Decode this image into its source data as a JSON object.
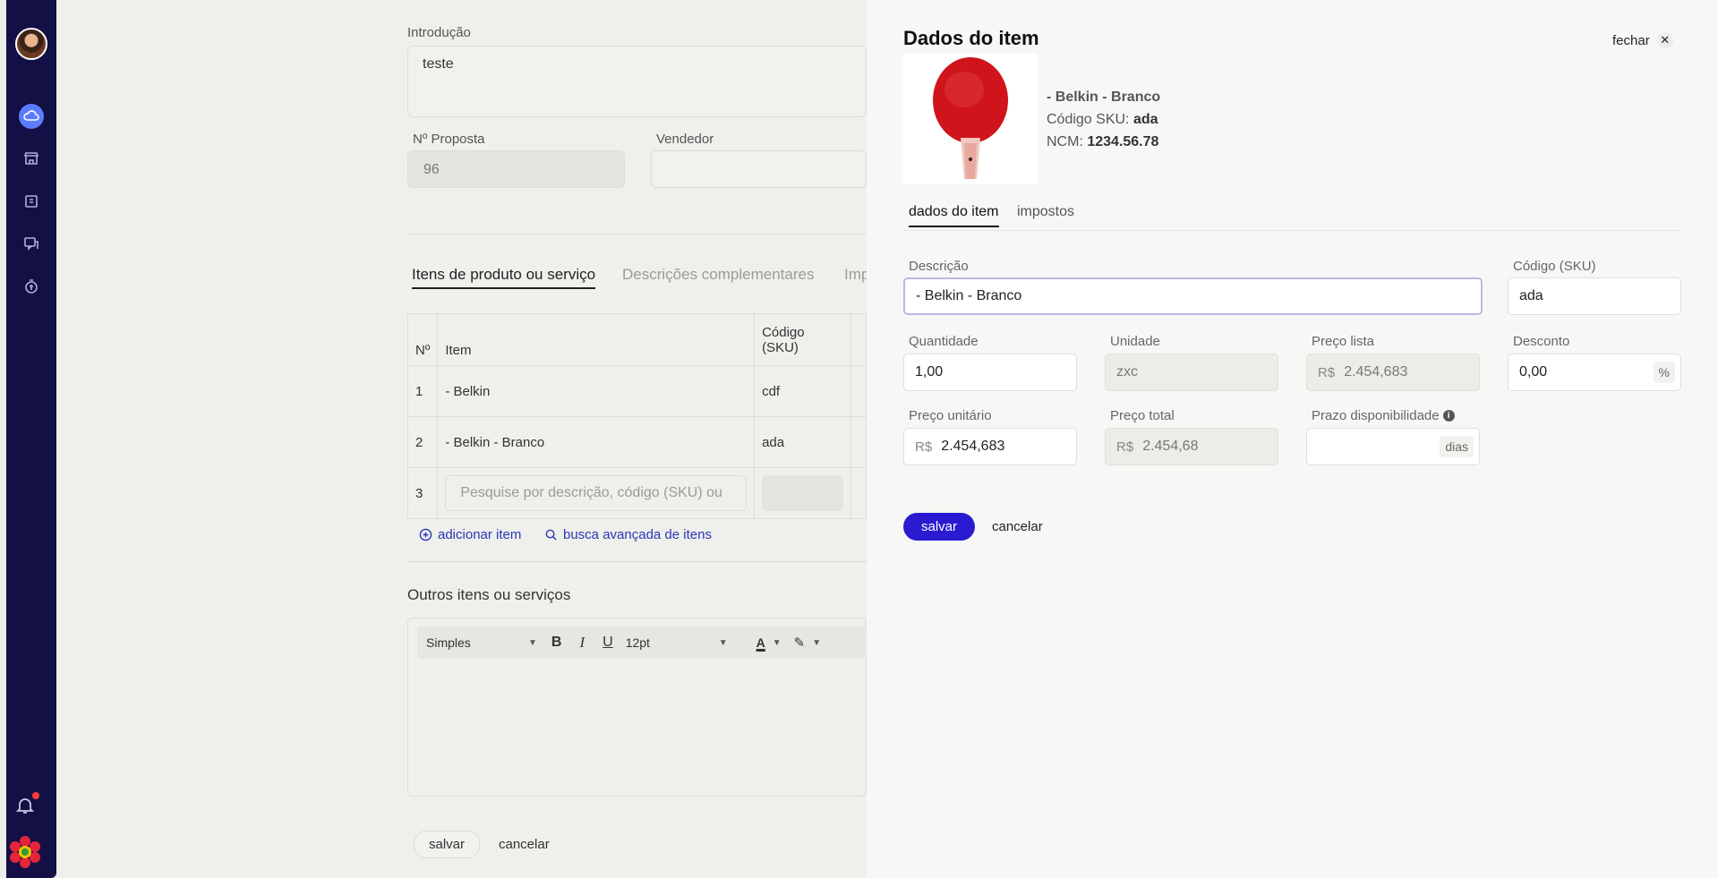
{
  "background": {
    "intro_label": "Introdução",
    "intro_value": "teste",
    "proposta_label": "Nº Proposta",
    "proposta_value": "96",
    "vendedor_label": "Vendedor",
    "tabs": [
      "Itens de produto ou serviço",
      "Descrições complementares",
      "Imp"
    ],
    "table": {
      "headers": [
        "Nº",
        "Item",
        "Código (SKU)"
      ],
      "rows": [
        {
          "n": "1",
          "item": "- Belkin",
          "sku": "cdf"
        },
        {
          "n": "2",
          "item": "- Belkin - Branco",
          "sku": "ada"
        },
        {
          "n": "3",
          "placeholder": "Pesquise por descrição, código (SKU) ou"
        }
      ]
    },
    "add_item": "adicionar item",
    "advanced_search": "busca avançada de itens",
    "outros_title": "Outros itens ou serviços",
    "toolbar": {
      "style": "Simples",
      "size": "12pt"
    },
    "save": "salvar",
    "cancel": "cancelar"
  },
  "panel": {
    "title": "Dados do item",
    "close": "fechar",
    "product": {
      "name": "- Belkin - Branco",
      "sku_label": "Código SKU:",
      "sku": "ada",
      "ncm_label": "NCM:",
      "ncm": "1234.56.78"
    },
    "tabs": [
      "dados do item",
      "impostos"
    ],
    "fields": {
      "descricao": {
        "label": "Descrição",
        "value": "- Belkin - Branco"
      },
      "codigo": {
        "label": "Código (SKU)",
        "value": "ada"
      },
      "quantidade": {
        "label": "Quantidade",
        "value": "1,00"
      },
      "unidade": {
        "label": "Unidade",
        "value": "zxc"
      },
      "preco_lista": {
        "label": "Preço lista",
        "prefix": "R$",
        "value": "2.454,683"
      },
      "desconto": {
        "label": "Desconto",
        "value": "0,00",
        "suffix": "%"
      },
      "preco_unitario": {
        "label": "Preço unitário",
        "prefix": "R$",
        "value": "2.454,683"
      },
      "preco_total": {
        "label": "Preço total",
        "prefix": "R$",
        "value": "2.454,68"
      },
      "prazo": {
        "label": "Prazo disponibilidade",
        "value": "",
        "suffix": "dias"
      }
    },
    "save": "salvar",
    "cancel": "cancelar"
  },
  "colors": {
    "sidebar": "#121045",
    "accent": "#2a1bd0",
    "active_nav": "#5b7cff"
  }
}
